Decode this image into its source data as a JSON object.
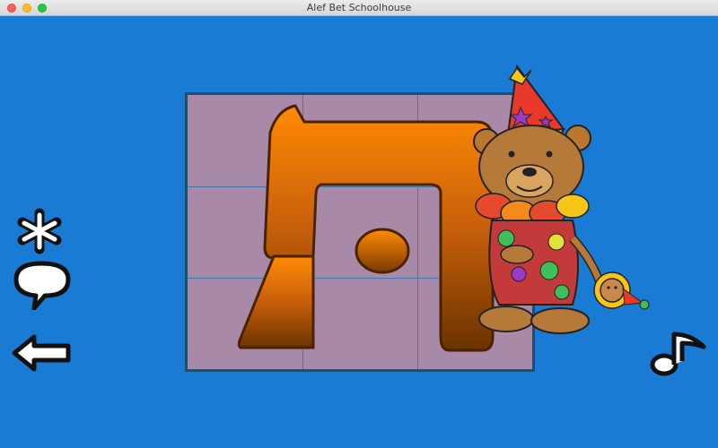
{
  "window": {
    "title": "Alef Bet Schoolhouse"
  },
  "colors": {
    "background": "#1a7bd4",
    "puzzle_board": "#a88aa8",
    "letter_top": "#ff8a05",
    "letter_bottom": "#6b3300"
  },
  "puzzle": {
    "letter": "ה",
    "rows": 3,
    "columns": 3
  },
  "controls": {
    "left": [
      "star-icon",
      "speech-bubble-icon",
      "back-arrow-icon"
    ],
    "right": [
      "music-note-icon"
    ]
  },
  "illustration": "clown-bear"
}
